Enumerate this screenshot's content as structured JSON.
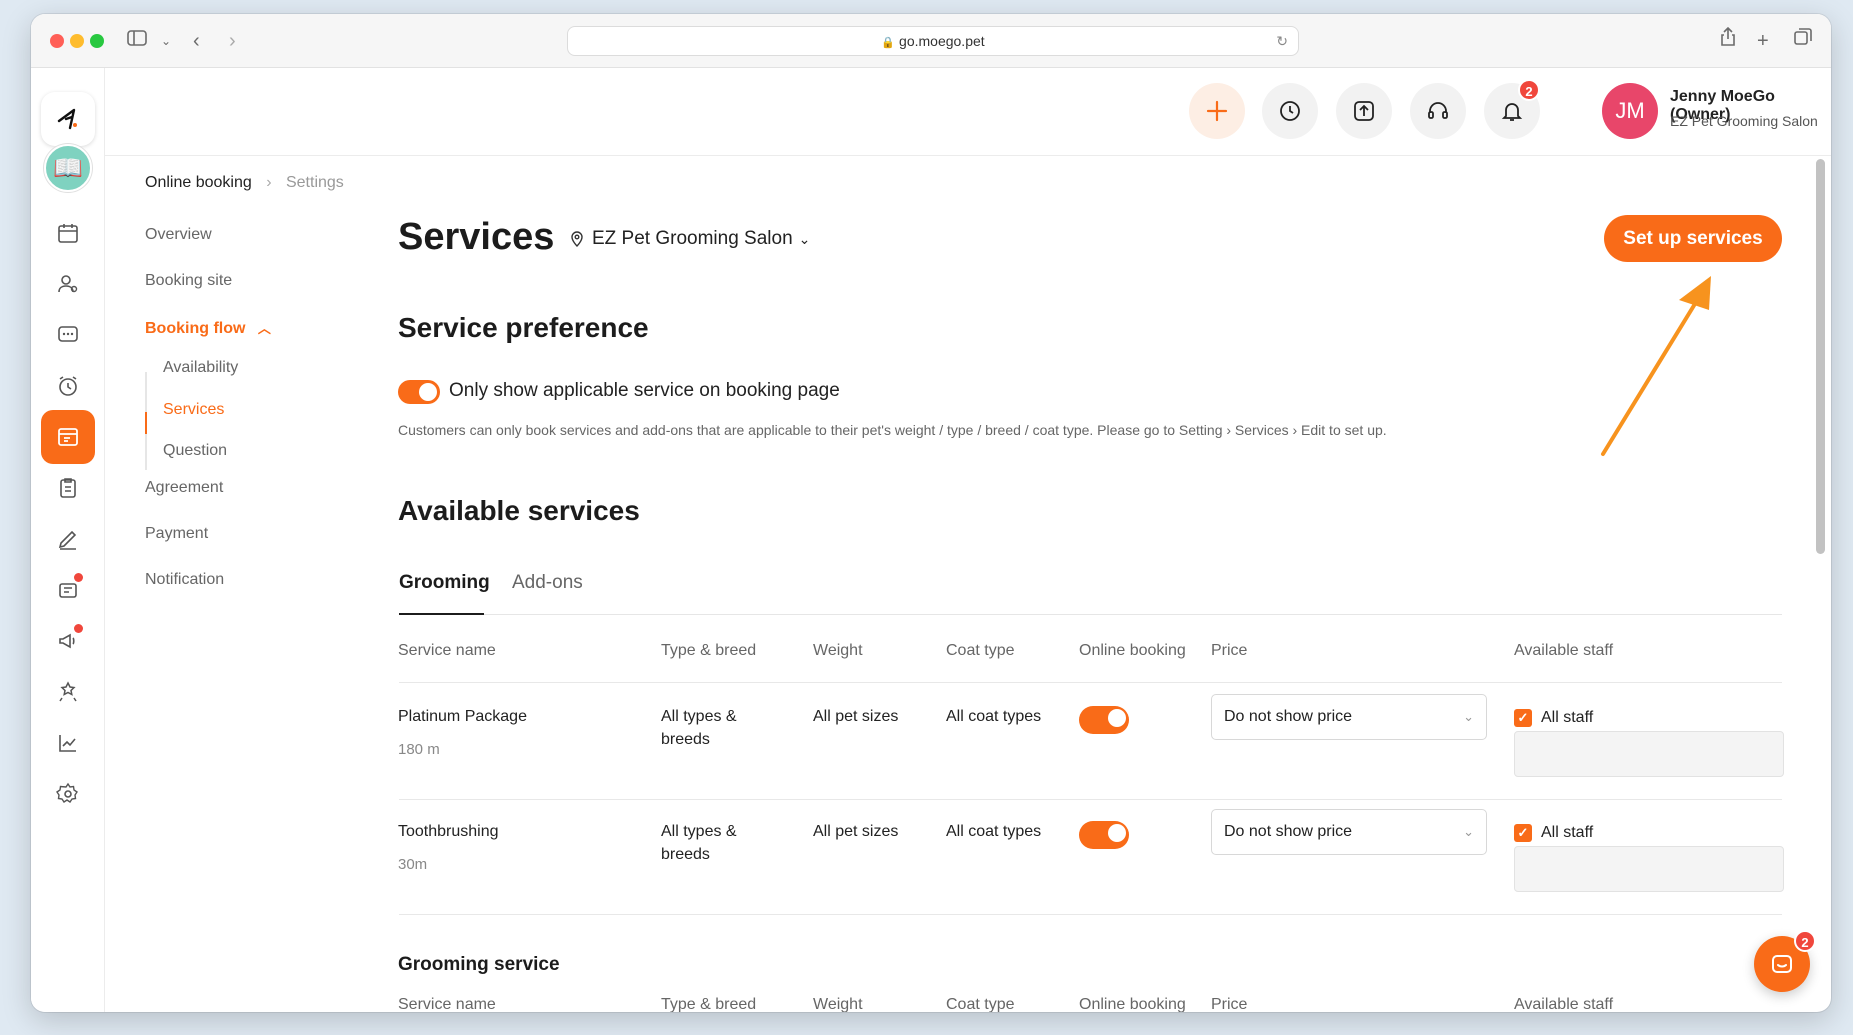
{
  "browser": {
    "url": "go.moego.pet"
  },
  "header": {
    "notification_count": "2",
    "user_initials": "JM",
    "user_name": "Jenny MoeGo (Owner)",
    "business_name": "EZ Pet Grooming Salon"
  },
  "breadcrumb": {
    "root": "Online booking",
    "current": "Settings"
  },
  "subnav": {
    "items": [
      "Overview",
      "Booking site",
      "Booking flow",
      "Agreement",
      "Payment",
      "Notification"
    ],
    "booking_flow_children": [
      "Availability",
      "Services",
      "Question"
    ]
  },
  "main": {
    "title": "Services",
    "location": "EZ Pet Grooming Salon",
    "setup_button": "Set up services",
    "preference_heading": "Service preference",
    "preference_toggle_label": "Only show applicable service on booking page",
    "preference_help": "Customers can only book services and add-ons that are applicable to their pet's weight / type / breed / coat type. Please go to Setting › Services › Edit to set up.",
    "available_heading": "Available services",
    "tabs": [
      "Grooming",
      "Add-ons"
    ],
    "columns": [
      "Service name",
      "Type & breed",
      "Weight",
      "Coat type",
      "Online booking",
      "Price",
      "Available staff"
    ],
    "rows": [
      {
        "name": "Platinum Package",
        "duration": "180 m",
        "type_breed_1": "All types &",
        "type_breed_2": "breeds",
        "weight": "All pet sizes",
        "coat": "All coat types",
        "price": "Do not show price",
        "staff": "All staff"
      },
      {
        "name": "Toothbrushing",
        "duration": "30m",
        "type_breed_1": "All types &",
        "type_breed_2": "breeds",
        "weight": "All pet sizes",
        "coat": "All coat types",
        "price": "Do not show price",
        "staff": "All staff"
      }
    ],
    "grooming_service_heading": "Grooming service"
  },
  "chat": {
    "badge": "2"
  },
  "colors": {
    "accent": "#f96b18",
    "badge": "#f0473c",
    "avatar": "#e8466a"
  }
}
